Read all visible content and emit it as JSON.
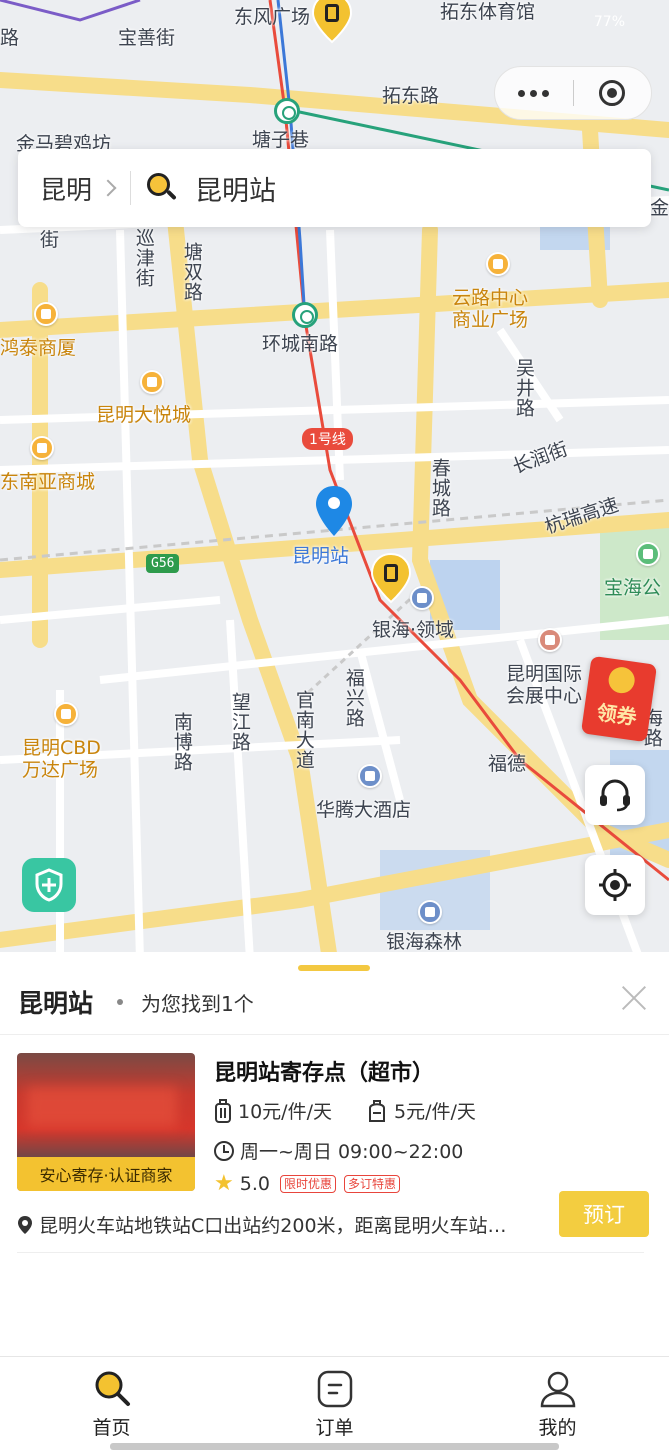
{
  "status_bar": {
    "network": "77%"
  },
  "capsule": {
    "more_icon": "more-dots-icon",
    "close_icon": "target-close-icon"
  },
  "search": {
    "city": "昆明",
    "query": "昆明站"
  },
  "map": {
    "labels": {
      "dongfeng_square": "东风广场",
      "tuodong_stadium": "拓东体育馆",
      "baoshan_street": "宝善街",
      "tuodong_road": "拓东路",
      "lu": "路",
      "jinmabiji": "金马碧鸡坊",
      "tangzi_lane": "塘子巷",
      "jin": "金",
      "jie": "街",
      "xunjin_street": "巡津街",
      "tangshuang_road": "塘双路",
      "yunlu_center": "云路中心\n商业广场",
      "hongtai_mall": "鸿泰商厦",
      "huancheng_south_road": "环城南路",
      "wujing_road": "吴井路",
      "kunming_dayue": "昆明大悦城",
      "line1": "1号线",
      "changrun_street": "长润街",
      "dongnanya_mall": "东南亚商城",
      "chuncheng_road": "春城路",
      "hangrui_expressway": "杭瑞高速",
      "kunming_station": "昆明站",
      "g56": "G56",
      "baohai_park": "宝海公",
      "yinhai_lingyu": "银海·领域",
      "kunming_expo": "昆明国际\n会展中心",
      "fuxing_road": "福兴路",
      "wangjiang_road": "望江路",
      "guannan_avenue": "官南大道",
      "nanbo_road": "南博路",
      "kunming_cbd": "昆明CBD\n万达广场",
      "fude": "福德",
      "hai_road": "海路",
      "huateng_hotel": "华腾大酒店",
      "yinhai_forest": "银海森林"
    },
    "red_packet": "领券"
  },
  "sheet": {
    "title": "昆明站",
    "found_text": "为您找到1个",
    "result": {
      "name": "昆明站寄存点（超市）",
      "badge": "安心寄存·认证商家",
      "price_large": "10元/件/天",
      "price_small": "5元/件/天",
      "hours": "周一~周日 09:00~22:00",
      "rating": "5.0",
      "tags": [
        "限时优惠",
        "多订特惠"
      ],
      "address": "昆明火车站地铁站C口出站约200米，距离昆明火车站…",
      "book_label": "预订"
    }
  },
  "tabs": [
    {
      "label": "首页",
      "icon": "search-icon"
    },
    {
      "label": "订单",
      "icon": "order-icon"
    },
    {
      "label": "我的",
      "icon": "user-icon"
    }
  ],
  "colors": {
    "accent": "#F3C230",
    "metro_red": "#E94B3C",
    "metro_blue": "#3C78D8"
  }
}
